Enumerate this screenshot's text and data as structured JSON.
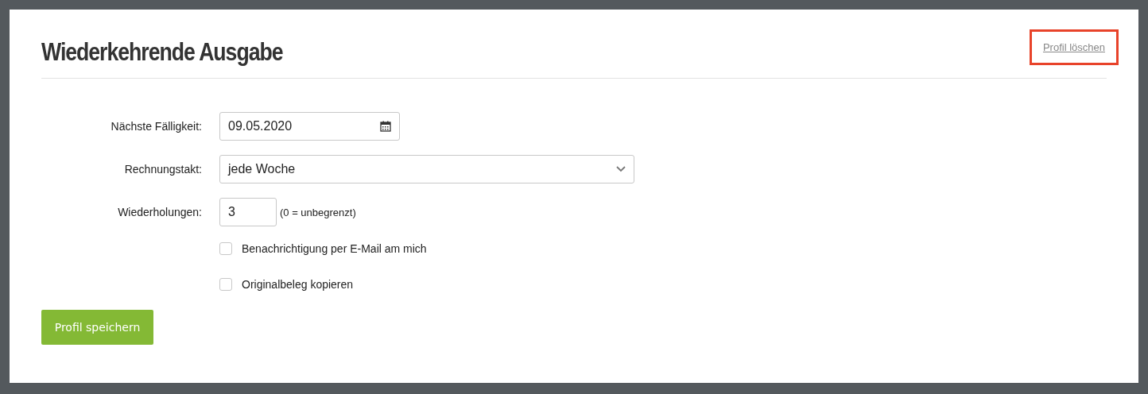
{
  "title": "Wiederkehrende Ausgabe",
  "delete_link": {
    "label": "Profil löschen",
    "highlighted": true
  },
  "fields": [
    {
      "kind": "date",
      "label": "Nächste Fälligkeit:",
      "value": "09.05.2020"
    },
    {
      "kind": "select",
      "label": "Rechnungstakt:",
      "value": "jede Woche"
    },
    {
      "kind": "number",
      "label": "Wiederholungen:",
      "value": "3",
      "hint": "(0 = unbegrenzt)"
    }
  ],
  "checkboxes": [
    {
      "label": "Benachrichtigung per E-Mail am mich",
      "checked": false
    },
    {
      "label": "Originalbeleg kopieren",
      "checked": false
    }
  ],
  "save_button": "Profil speichern"
}
